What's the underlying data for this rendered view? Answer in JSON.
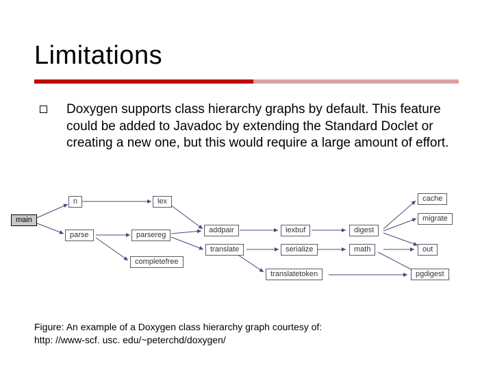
{
  "title": "Limitations",
  "bullet": {
    "text": "Doxygen supports class hierarchy graphs by default. This feature could be added to Javadoc by extending the Standard Doclet or creating a new one, but this would require a large amount of effort."
  },
  "diagram": {
    "nodes": {
      "main": "main",
      "n": "n",
      "parse": "parse",
      "lex": "lex",
      "parsereg": "parsereg",
      "completefree": "completefree",
      "addpair": "addpair",
      "translate": "translate",
      "translatetoken": "translatetoken",
      "lexbuf": "lexbuf",
      "serialize": "serialize",
      "digest": "digest",
      "math": "math",
      "cache": "cache",
      "migrate": "migrate",
      "out": "out",
      "pgdigest": "pgdigest"
    }
  },
  "caption": {
    "line1": "Figure: An example of a Doxygen class hierarchy graph courtesy of:",
    "line2": "http: //www-scf. usc. edu/~peterchd/doxygen/"
  }
}
